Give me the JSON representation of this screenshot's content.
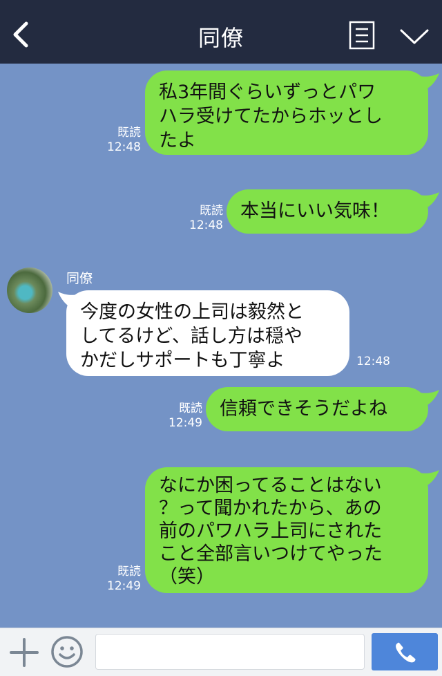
{
  "header": {
    "title": "同僚"
  },
  "messages": [
    {
      "side": "me",
      "lines": [
        "私3年間ぐらいずっとパワ",
        "ハラ受けてたからホッとし",
        "たよ"
      ],
      "read": "既読",
      "time": "12:48"
    },
    {
      "side": "me",
      "lines": [
        "本当にいい気味！"
      ],
      "read": "既読",
      "time": "12:48"
    },
    {
      "side": "other",
      "sender": "同僚",
      "lines": [
        "今度の女性の上司は毅然と",
        "してるけど、話し方は穏や",
        "かだしサポートも丁寧よ"
      ],
      "time": "12:48"
    },
    {
      "side": "me",
      "lines": [
        "信頼できそうだよね"
      ],
      "read": "既読",
      "time": "12:49"
    },
    {
      "side": "me",
      "lines": [
        "なにか困ってることはない",
        "？って聞かれたから、あの",
        "前のパワハラ上司にされた",
        "こと全部言いつけてやった",
        "（笑）"
      ],
      "read": "既読",
      "time": "12:49"
    }
  ],
  "input": {
    "value": "",
    "placeholder": ""
  },
  "icons": {
    "back": "chevron-left-icon",
    "menu": "document-menu-icon",
    "collapse": "chevron-down-icon",
    "add": "plus-icon",
    "emoji": "smiley-icon",
    "call": "phone-icon"
  },
  "colors": {
    "header": "#232b40",
    "background": "#7493c6",
    "my_bubble": "#82e149",
    "their_bubble": "#ffffff",
    "call_button": "#4e86da"
  }
}
